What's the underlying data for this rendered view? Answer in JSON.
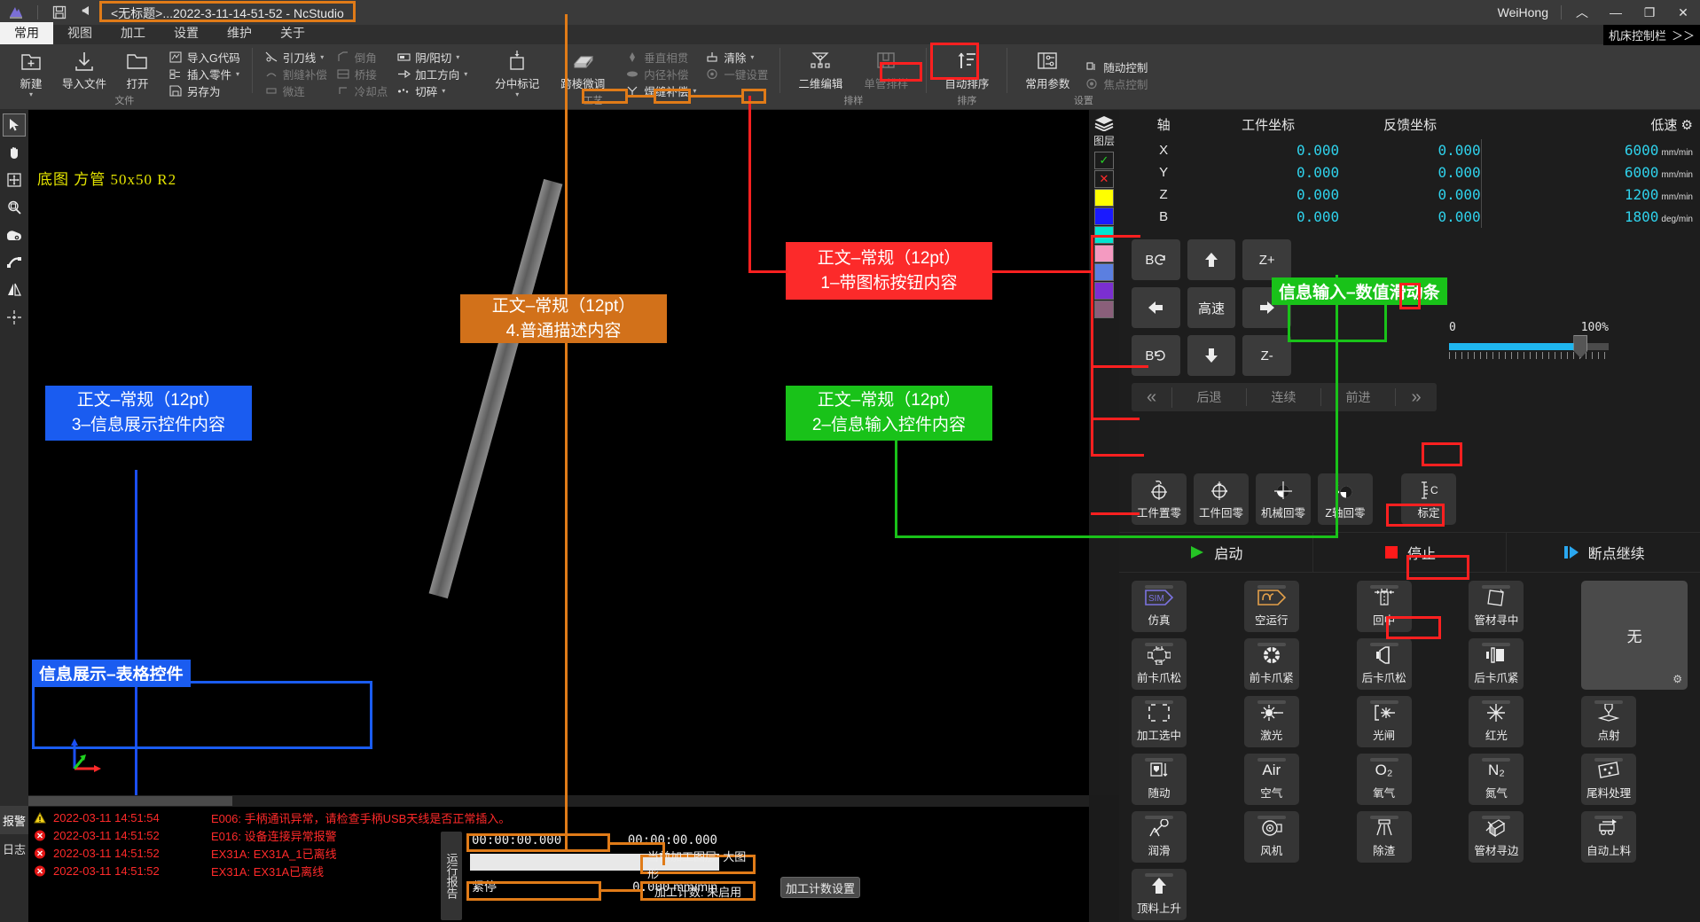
{
  "titlebar": {
    "document_title": "<无标题>...2022-3-11-14-51-52 - NcStudio",
    "brand": "WeiHong",
    "icons": {
      "app": "app-logo-icon",
      "save": "save-icon",
      "undo": "undo-icon",
      "redo": "redo-icon"
    },
    "window_buttons": {
      "collapse": "︿",
      "minimize": "—",
      "maximize": "❐",
      "close": "✕"
    }
  },
  "machine_bar_toggle": {
    "label": "机床控制栏",
    "chevrons": "＞＞"
  },
  "ribbon": {
    "tabs": [
      {
        "label": "常用",
        "active": true
      },
      {
        "label": "视图",
        "active": false
      },
      {
        "label": "加工",
        "active": false
      },
      {
        "label": "设置",
        "active": false
      },
      {
        "label": "维护",
        "active": false
      },
      {
        "label": "关于",
        "active": false
      }
    ],
    "groups": [
      {
        "title": "文件",
        "big": [
          {
            "label": "新建",
            "icon": "new-file-icon",
            "caret": true
          },
          {
            "label": "导入文件",
            "icon": "import-file-icon",
            "caret": false
          },
          {
            "label": "打开",
            "icon": "open-folder-icon",
            "caret": false
          }
        ],
        "small": [
          {
            "label": "导入G代码",
            "icon": "g-code-icon",
            "caret": false,
            "disabled": false
          },
          {
            "label": "插入零件",
            "icon": "insert-part-icon",
            "caret": true,
            "disabled": false
          },
          {
            "label": "另存为",
            "icon": "save-as-icon",
            "caret": false,
            "disabled": false
          }
        ]
      },
      {
        "title": "",
        "small_cols": [
          [
            {
              "label": "引刀线",
              "icon": "lead-line-icon",
              "caret": true,
              "disabled": false
            },
            {
              "label": "割缝补偿",
              "icon": "kerf-comp-icon",
              "caret": false,
              "disabled": true
            },
            {
              "label": "微连",
              "icon": "micro-joint-icon",
              "caret": false,
              "disabled": true
            }
          ],
          [
            {
              "label": "倒角",
              "icon": "chamfer-icon",
              "caret": false,
              "disabled": true
            },
            {
              "label": "桥接",
              "icon": "bridge-icon",
              "caret": false,
              "disabled": true
            },
            {
              "label": "冷却点",
              "icon": "cooling-point-icon",
              "caret": false,
              "disabled": true
            }
          ],
          [
            {
              "label": "阴/阳切",
              "icon": "inner-outer-cut-icon",
              "caret": true,
              "disabled": false
            },
            {
              "label": "加工方向",
              "icon": "machining-direction-icon",
              "caret": true,
              "disabled": false
            },
            {
              "label": "切碎",
              "icon": "shred-icon",
              "caret": true,
              "disabled": false
            }
          ]
        ]
      },
      {
        "title": "工艺",
        "big": [
          {
            "label": "分中标记",
            "icon": "center-mark-icon",
            "caret": true
          },
          {
            "label": "跨棱微调",
            "icon": "cross-edge-tune-icon",
            "caret": false
          }
        ],
        "small_cols": [
          [
            {
              "label": "垂直相贯",
              "icon": "vertical-intersect-icon",
              "caret": false,
              "disabled": true
            },
            {
              "label": "内径补偿",
              "icon": "inner-dia-comp-icon",
              "caret": false,
              "disabled": true
            },
            {
              "label": "焊缝补偿",
              "icon": "weld-comp-icon",
              "caret": true,
              "disabled": false
            }
          ],
          [
            {
              "label": "清除",
              "icon": "clear-icon",
              "caret": true,
              "disabled": false
            },
            {
              "label": "一键设置",
              "icon": "one-key-setup-icon",
              "caret": false,
              "disabled": true
            }
          ]
        ]
      },
      {
        "title": "排样",
        "big": [
          {
            "label": "二维编辑",
            "icon": "2d-edit-icon",
            "caret": false
          },
          {
            "label": "单管排样",
            "icon": "single-tube-nesting-icon",
            "caret": false,
            "disabled": true
          }
        ]
      },
      {
        "title": "排序",
        "big": [
          {
            "label": "自动排序",
            "icon": "auto-sort-icon",
            "caret": false
          }
        ]
      },
      {
        "title": "设置",
        "big": [
          {
            "label": "常用参数",
            "icon": "common-params-icon",
            "caret": false
          }
        ],
        "small": [
          {
            "label": "随动控制",
            "icon": "follow-control-icon",
            "caret": false,
            "disabled": false
          },
          {
            "label": "焦点控制",
            "icon": "focus-control-icon",
            "caret": false,
            "disabled": true
          }
        ]
      }
    ]
  },
  "left_tools": [
    {
      "name": "select-arrow-icon",
      "selected": true
    },
    {
      "name": "pan-hand-icon",
      "selected": false
    },
    {
      "name": "move-icon",
      "selected": false
    },
    {
      "name": "zoom-magnifier-icon",
      "selected": false
    },
    {
      "name": "camera-icon",
      "selected": false
    },
    {
      "name": "node-edit-icon",
      "selected": false
    },
    {
      "name": "mirror-icon",
      "selected": false
    },
    {
      "name": "crosshair-icon",
      "selected": false
    }
  ],
  "canvas": {
    "label": "底图  方管 50x50 R2"
  },
  "layers": {
    "title": "图层",
    "icon": "layers-stack-icon",
    "swatches": [
      {
        "color": "#1c1c1c",
        "glyph": "✓",
        "glyph_color": "#27d427"
      },
      {
        "color": "#1c1c1c",
        "glyph": "✕",
        "glyph_color": "#ff2a2a"
      },
      {
        "color": "#ffff00",
        "glyph": ""
      },
      {
        "color": "#1a1aff",
        "glyph": ""
      },
      {
        "color": "#00e5d0",
        "glyph": ""
      },
      {
        "color": "#f49ac1",
        "glyph": ""
      },
      {
        "color": "#5b7fe0",
        "glyph": ""
      },
      {
        "color": "#7b2fd0",
        "glyph": ""
      },
      {
        "color": "#8a5f7a",
        "glyph": ""
      }
    ]
  },
  "coords": {
    "headers": [
      "轴",
      "工件坐标",
      "反馈坐标",
      "低速"
    ],
    "speed_mode_icon": "gear-icon",
    "rows": [
      {
        "axis": "X",
        "work": "0.000",
        "feedback": "0.000",
        "speed": "6000",
        "unit": "mm/min"
      },
      {
        "axis": "Y",
        "work": "0.000",
        "feedback": "0.000",
        "speed": "6000",
        "unit": "mm/min"
      },
      {
        "axis": "Z",
        "work": "0.000",
        "feedback": "0.000",
        "speed": "1200",
        "unit": "mm/min"
      },
      {
        "axis": "B",
        "work": "0.000",
        "feedback": "0.000",
        "speed": "1800",
        "unit": "deg/min"
      }
    ]
  },
  "jog": {
    "keys": [
      {
        "label": "B",
        "icon": "rotate-ccw-icon"
      },
      {
        "label": "",
        "icon": "arrow-up-icon"
      },
      {
        "label": "Z+",
        "icon": ""
      },
      {
        "label": "",
        "icon": "arrow-left-icon"
      },
      {
        "label": "高速",
        "icon": ""
      },
      {
        "label": "",
        "icon": "arrow-right-icon"
      },
      {
        "label": "B",
        "icon": "rotate-cw-icon"
      },
      {
        "label": "",
        "icon": "arrow-down-icon"
      },
      {
        "label": "Z-",
        "icon": ""
      }
    ],
    "wheel": [
      {
        "label": "",
        "icon": "double-left-icon"
      },
      {
        "label": "后退",
        "icon": ""
      },
      {
        "label": "连续",
        "icon": ""
      },
      {
        "label": "前进",
        "icon": ""
      },
      {
        "label": "",
        "icon": "double-right-icon"
      }
    ]
  },
  "slider": {
    "min_label": "0",
    "max_label": "100%",
    "value": 84
  },
  "zero_row": [
    {
      "label": "工件置零",
      "icon": "work-zero-set-icon"
    },
    {
      "label": "工件回零",
      "icon": "work-go-zero-icon"
    },
    {
      "label": "机械回零",
      "icon": "machine-home-icon"
    },
    {
      "label": "Z轴回零",
      "icon": "z-axis-home-icon"
    },
    {
      "label": "标定",
      "icon": "calibrate-icon"
    }
  ],
  "run_row": [
    {
      "label": "启动",
      "icon": "play-triangle-icon",
      "color": "#25c425"
    },
    {
      "label": "停止",
      "icon": "stop-square-icon",
      "color": "#ff1a1a"
    },
    {
      "label": "断点继续",
      "icon": "resume-icon",
      "color": "#2aa8f0"
    }
  ],
  "func_tiles": [
    {
      "label": "仿真",
      "icon": "sim-icon"
    },
    {
      "label": "空运行",
      "icon": "dry-run-icon"
    },
    {
      "label": "回中",
      "icon": "return-center-icon"
    },
    {
      "label": "管材寻中",
      "icon": "tube-center-find-icon"
    },
    {
      "label": "无",
      "icon": "none-mode-icon",
      "is_mode": true
    },
    {
      "label": "前卡爪松",
      "icon": "front-chuck-loose-icon"
    },
    {
      "label": "前卡爪紧",
      "icon": "front-chuck-tight-icon"
    },
    {
      "label": "后卡爪松",
      "icon": "rear-chuck-loose-icon"
    },
    {
      "label": "后卡爪紧",
      "icon": "rear-chuck-tight-icon"
    },
    {
      "label": "加工选中",
      "icon": "machine-selected-icon"
    },
    {
      "label": "激光",
      "icon": "laser-icon"
    },
    {
      "label": "光闸",
      "icon": "shutter-icon"
    },
    {
      "label": "红光",
      "icon": "red-light-icon"
    },
    {
      "label": "点射",
      "icon": "pulse-shot-icon"
    },
    {
      "label": "随动",
      "icon": "follow-icon"
    },
    {
      "label": "空气",
      "icon": "air-icon",
      "sup": "Air"
    },
    {
      "label": "氧气",
      "icon": "o2-icon",
      "sup": "O₂"
    },
    {
      "label": "氮气",
      "icon": "n2-icon",
      "sup": "N₂"
    },
    {
      "label": "尾料处理",
      "icon": "tail-material-icon"
    },
    {
      "label": "润滑",
      "icon": "lubrication-icon"
    },
    {
      "label": "风机",
      "icon": "blower-icon"
    },
    {
      "label": "除渣",
      "icon": "slag-removal-icon"
    },
    {
      "label": "管材寻边",
      "icon": "tube-edge-find-icon"
    },
    {
      "label": "自动上料",
      "icon": "auto-feed-icon"
    },
    {
      "label": "顶料上升",
      "icon": "material-lift-icon"
    }
  ],
  "log": {
    "tabs": [
      {
        "label": "报警",
        "active": true
      },
      {
        "label": "日志",
        "active": false
      }
    ],
    "rows": [
      {
        "icon": "warning-triangle-icon",
        "time": "2022-03-11 14:51:54",
        "message": "E006: 手柄通讯异常，请检查手柄USB天线是否正常插入。"
      },
      {
        "icon": "error-circle-icon",
        "time": "2022-03-11 14:51:52",
        "message": "E016: 设备连接异常报警"
      },
      {
        "icon": "error-circle-icon",
        "time": "2022-03-11 14:51:52",
        "message": "EX31A: EX31A_1已离线"
      },
      {
        "icon": "error-circle-icon",
        "time": "2022-03-11 14:51:52",
        "message": "EX31A: EX31A已离线"
      }
    ]
  },
  "report": {
    "tab_label": "运行报告",
    "time_elapsed": "00:00:00.000",
    "time_total": "00:00:00.000",
    "state_label": "紧停",
    "feed_value": "0.000",
    "feed_unit": "mm/min",
    "current_layer": "当前加工图层: 大图形",
    "count_status": "加工计数: 未启用",
    "count_button": "加工计数设置"
  },
  "annotations": {
    "orange_box": {
      "line1": "正文–常规（12pt）",
      "line2": "4.普通描述内容",
      "color": "#d2711a"
    },
    "red_box": {
      "line1": "正文–常规（12pt）",
      "line2": "1–带图标按钮内容",
      "color": "#fc2a2a"
    },
    "green_box": {
      "line1": "正文–常规（12pt）",
      "line2": "2–信息输入控件内容",
      "color": "#19c219"
    },
    "blue_box": {
      "line1": "正文–常规（12pt）",
      "line2": "3–信息展示控件内容",
      "color": "#1a5cf0"
    },
    "slider_label": {
      "text": "信息输入–数值滑动条",
      "color": "#19c219"
    },
    "table_label": {
      "text": "信息展示–表格控件",
      "color": "#1a5cf0"
    }
  }
}
